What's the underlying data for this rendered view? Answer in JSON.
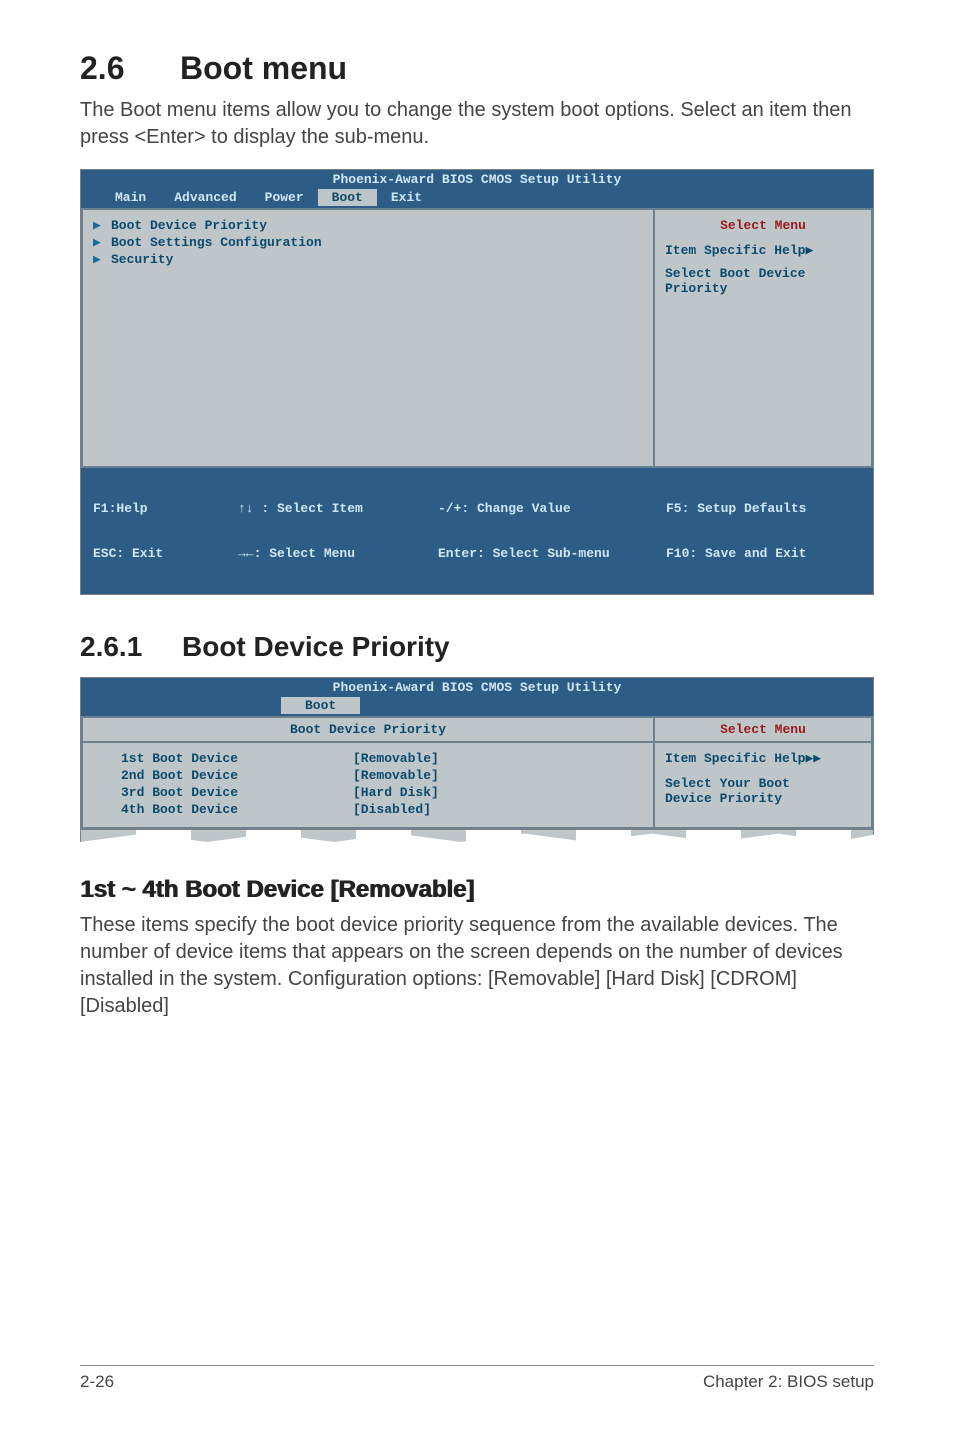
{
  "section": {
    "number": "2.6",
    "title": "Boot menu"
  },
  "intro": "The Boot menu items allow you to change the system boot options. Select an item then press <Enter> to display the sub-menu.",
  "bios1": {
    "title": "Phoenix-Award BIOS CMOS Setup Utility",
    "tabs": [
      "Main",
      "Advanced",
      "Power",
      "Boot",
      "Exit"
    ],
    "activeTab": "Boot",
    "items": [
      {
        "label": "Boot Device Priority",
        "submenu": true
      },
      {
        "label": "Boot Settings Configuration",
        "submenu": true
      },
      {
        "label": "Security",
        "submenu": true
      }
    ],
    "help": {
      "selectMenu": "Select Menu",
      "specific": "Item Specific Help",
      "desc": "Select Boot Device Priority"
    },
    "footer": {
      "f1": "F1:Help",
      "esc": "ESC: Exit",
      "updown": "↑↓ : Select Item",
      "leftright": "→←: Select Menu",
      "change": "-/+: Change Value",
      "enter": "Enter: Select Sub-menu",
      "f5": "F5: Setup Defaults",
      "f10": "F10: Save and Exit"
    }
  },
  "sub": {
    "number": "2.6.1",
    "title": "Boot Device Priority"
  },
  "bios2": {
    "title": "Phoenix-Award BIOS CMOS Setup Utility",
    "activeTab": "Boot",
    "leftHeader": "Boot Device Priority",
    "devices": [
      {
        "label": "1st Boot Device",
        "value": "[Removable]"
      },
      {
        "label": "2nd Boot Device",
        "value": "[Removable]"
      },
      {
        "label": "3rd Boot Device",
        "value": "[Hard Disk]"
      },
      {
        "label": "4th Boot Device",
        "value": "[Disabled]"
      }
    ],
    "help": {
      "selectMenu": "Select Menu",
      "specific": "Item Specific Help",
      "desc1": "Select Your Boot",
      "desc2": "Device Priority"
    }
  },
  "subitem": {
    "heading": "1st ~ 4th Boot Device [Removable]"
  },
  "body": "These items specify the boot device priority sequence from the available devices. The number of device items that appears on the screen depends on the number of devices installed in the system. Configuration options: [Removable] [Hard Disk] [CDROM] [Disabled]",
  "footer": {
    "page": "2-26",
    "chapter": "Chapter 2: BIOS setup"
  }
}
